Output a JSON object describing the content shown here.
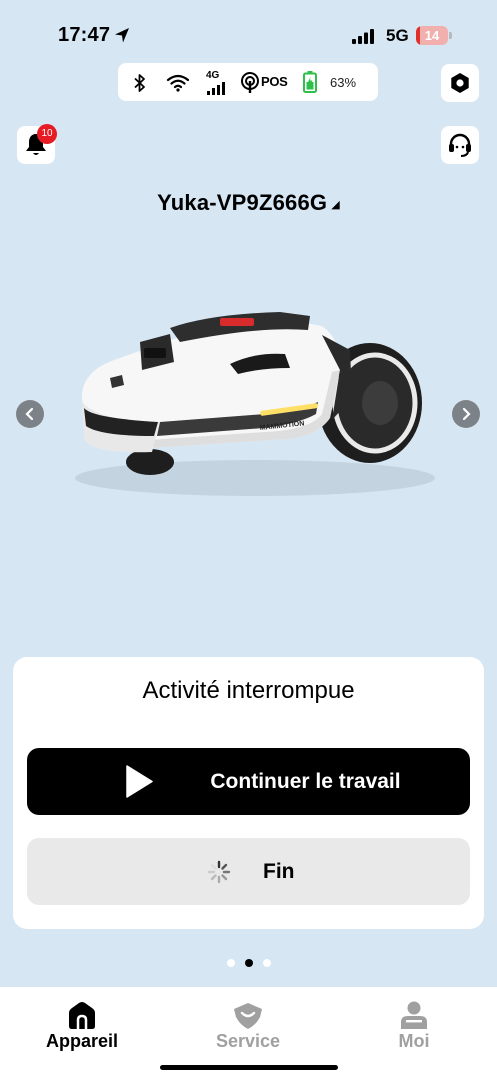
{
  "status_bar": {
    "time": "17:47",
    "network": "5G",
    "battery_level": "14",
    "battery_fraction": 0.14
  },
  "robot_status": {
    "cellular_label": "4G",
    "pos_label": "POS",
    "battery_percent": "63%"
  },
  "notifications": {
    "count": "10"
  },
  "device": {
    "name": "Yuka-VP9Z666G",
    "caret": "◢",
    "brand_mark": "MAMMOTION"
  },
  "card": {
    "title": "Activité interrompue",
    "continue_label": "Continuer le travail",
    "end_label": "Fin"
  },
  "pager": {
    "count": 3,
    "active": 1
  },
  "tabs": [
    {
      "label": "Appareil",
      "icon": "home-icon",
      "active": true
    },
    {
      "label": "Service",
      "icon": "service-shield-icon",
      "active": false
    },
    {
      "label": "Moi",
      "icon": "person-icon",
      "active": false
    }
  ],
  "colors": {
    "background": "#d6e6f3",
    "badge": "#e61b23",
    "battery_low": "#e0302c",
    "battery_ok": "#2fbf4a",
    "primary_button": "#000000",
    "secondary_button": "#e9e9e9",
    "inactive_tab": "#a0a0a0"
  }
}
